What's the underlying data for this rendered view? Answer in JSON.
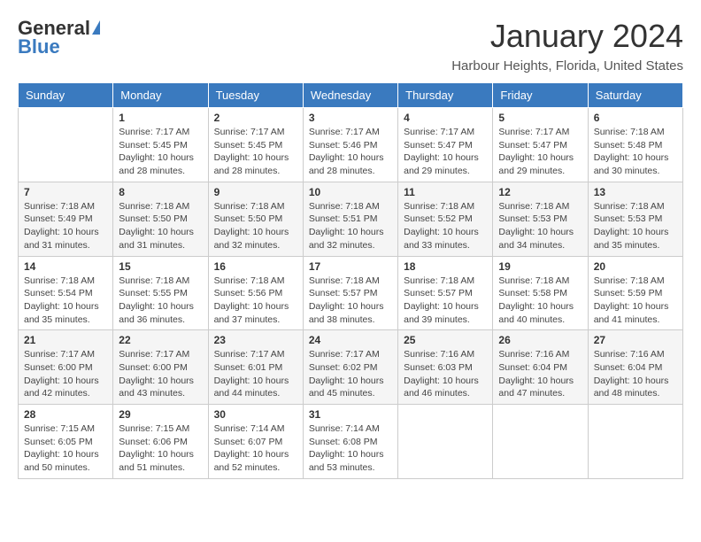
{
  "header": {
    "logo_line1": "General",
    "logo_line2": "Blue",
    "title": "January 2024",
    "subtitle": "Harbour Heights, Florida, United States"
  },
  "weekdays": [
    "Sunday",
    "Monday",
    "Tuesday",
    "Wednesday",
    "Thursday",
    "Friday",
    "Saturday"
  ],
  "weeks": [
    [
      {
        "day": "",
        "info": ""
      },
      {
        "day": "1",
        "info": "Sunrise: 7:17 AM\nSunset: 5:45 PM\nDaylight: 10 hours\nand 28 minutes."
      },
      {
        "day": "2",
        "info": "Sunrise: 7:17 AM\nSunset: 5:45 PM\nDaylight: 10 hours\nand 28 minutes."
      },
      {
        "day": "3",
        "info": "Sunrise: 7:17 AM\nSunset: 5:46 PM\nDaylight: 10 hours\nand 28 minutes."
      },
      {
        "day": "4",
        "info": "Sunrise: 7:17 AM\nSunset: 5:47 PM\nDaylight: 10 hours\nand 29 minutes."
      },
      {
        "day": "5",
        "info": "Sunrise: 7:17 AM\nSunset: 5:47 PM\nDaylight: 10 hours\nand 29 minutes."
      },
      {
        "day": "6",
        "info": "Sunrise: 7:18 AM\nSunset: 5:48 PM\nDaylight: 10 hours\nand 30 minutes."
      }
    ],
    [
      {
        "day": "7",
        "info": "Sunrise: 7:18 AM\nSunset: 5:49 PM\nDaylight: 10 hours\nand 31 minutes."
      },
      {
        "day": "8",
        "info": "Sunrise: 7:18 AM\nSunset: 5:50 PM\nDaylight: 10 hours\nand 31 minutes."
      },
      {
        "day": "9",
        "info": "Sunrise: 7:18 AM\nSunset: 5:50 PM\nDaylight: 10 hours\nand 32 minutes."
      },
      {
        "day": "10",
        "info": "Sunrise: 7:18 AM\nSunset: 5:51 PM\nDaylight: 10 hours\nand 32 minutes."
      },
      {
        "day": "11",
        "info": "Sunrise: 7:18 AM\nSunset: 5:52 PM\nDaylight: 10 hours\nand 33 minutes."
      },
      {
        "day": "12",
        "info": "Sunrise: 7:18 AM\nSunset: 5:53 PM\nDaylight: 10 hours\nand 34 minutes."
      },
      {
        "day": "13",
        "info": "Sunrise: 7:18 AM\nSunset: 5:53 PM\nDaylight: 10 hours\nand 35 minutes."
      }
    ],
    [
      {
        "day": "14",
        "info": "Sunrise: 7:18 AM\nSunset: 5:54 PM\nDaylight: 10 hours\nand 35 minutes."
      },
      {
        "day": "15",
        "info": "Sunrise: 7:18 AM\nSunset: 5:55 PM\nDaylight: 10 hours\nand 36 minutes."
      },
      {
        "day": "16",
        "info": "Sunrise: 7:18 AM\nSunset: 5:56 PM\nDaylight: 10 hours\nand 37 minutes."
      },
      {
        "day": "17",
        "info": "Sunrise: 7:18 AM\nSunset: 5:57 PM\nDaylight: 10 hours\nand 38 minutes."
      },
      {
        "day": "18",
        "info": "Sunrise: 7:18 AM\nSunset: 5:57 PM\nDaylight: 10 hours\nand 39 minutes."
      },
      {
        "day": "19",
        "info": "Sunrise: 7:18 AM\nSunset: 5:58 PM\nDaylight: 10 hours\nand 40 minutes."
      },
      {
        "day": "20",
        "info": "Sunrise: 7:18 AM\nSunset: 5:59 PM\nDaylight: 10 hours\nand 41 minutes."
      }
    ],
    [
      {
        "day": "21",
        "info": "Sunrise: 7:17 AM\nSunset: 6:00 PM\nDaylight: 10 hours\nand 42 minutes."
      },
      {
        "day": "22",
        "info": "Sunrise: 7:17 AM\nSunset: 6:00 PM\nDaylight: 10 hours\nand 43 minutes."
      },
      {
        "day": "23",
        "info": "Sunrise: 7:17 AM\nSunset: 6:01 PM\nDaylight: 10 hours\nand 44 minutes."
      },
      {
        "day": "24",
        "info": "Sunrise: 7:17 AM\nSunset: 6:02 PM\nDaylight: 10 hours\nand 45 minutes."
      },
      {
        "day": "25",
        "info": "Sunrise: 7:16 AM\nSunset: 6:03 PM\nDaylight: 10 hours\nand 46 minutes."
      },
      {
        "day": "26",
        "info": "Sunrise: 7:16 AM\nSunset: 6:04 PM\nDaylight: 10 hours\nand 47 minutes."
      },
      {
        "day": "27",
        "info": "Sunrise: 7:16 AM\nSunset: 6:04 PM\nDaylight: 10 hours\nand 48 minutes."
      }
    ],
    [
      {
        "day": "28",
        "info": "Sunrise: 7:15 AM\nSunset: 6:05 PM\nDaylight: 10 hours\nand 50 minutes."
      },
      {
        "day": "29",
        "info": "Sunrise: 7:15 AM\nSunset: 6:06 PM\nDaylight: 10 hours\nand 51 minutes."
      },
      {
        "day": "30",
        "info": "Sunrise: 7:14 AM\nSunset: 6:07 PM\nDaylight: 10 hours\nand 52 minutes."
      },
      {
        "day": "31",
        "info": "Sunrise: 7:14 AM\nSunset: 6:08 PM\nDaylight: 10 hours\nand 53 minutes."
      },
      {
        "day": "",
        "info": ""
      },
      {
        "day": "",
        "info": ""
      },
      {
        "day": "",
        "info": ""
      }
    ]
  ]
}
